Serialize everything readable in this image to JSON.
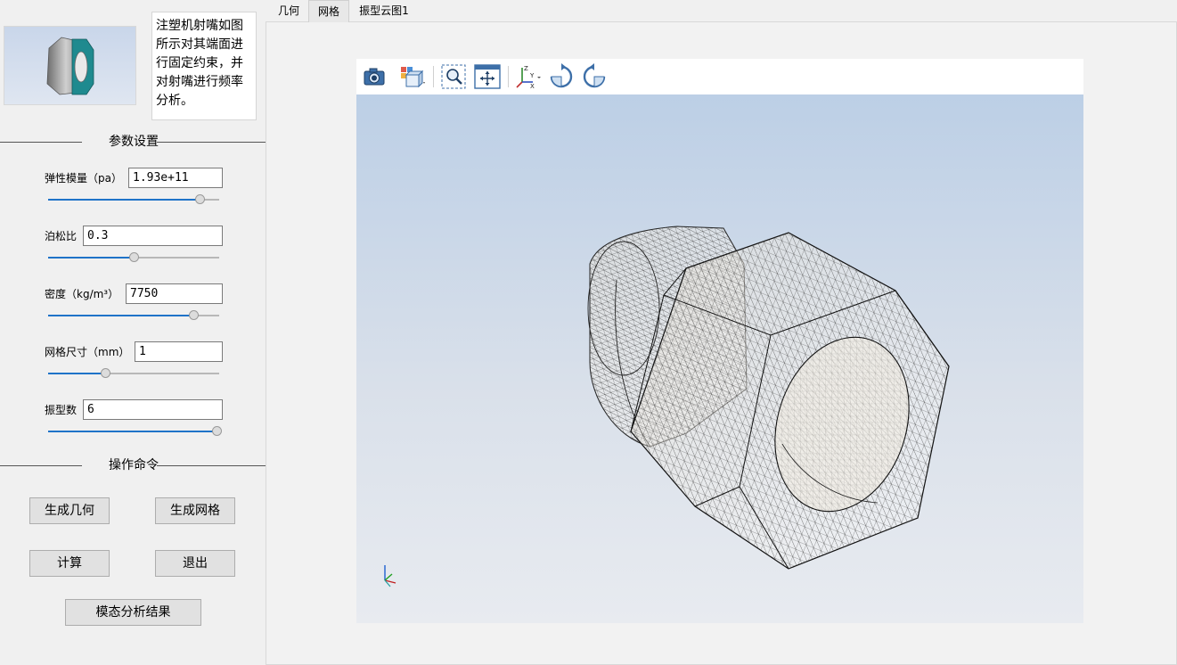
{
  "description": "注塑机射嘴如图所示对其端面进行固定约束，并对射嘴进行频率分析。",
  "sections": {
    "params_title": "参数设置",
    "ops_title": "操作命令"
  },
  "params": [
    {
      "label": "弹性模量（pa）",
      "value": "1.93e+11",
      "slider_fraction": 0.9
    },
    {
      "label": "泊松比",
      "value": "0.3",
      "slider_fraction": 0.5
    },
    {
      "label": "密度（kg/m³）",
      "value": "7750",
      "slider_fraction": 0.86
    },
    {
      "label": "网格尺寸（mm）",
      "value": "1",
      "slider_fraction": 0.33
    },
    {
      "label": "振型数",
      "value": "6",
      "slider_fraction": 1.0
    }
  ],
  "buttons": {
    "gen_geometry": "生成几何",
    "gen_mesh": "生成网格",
    "compute": "计算",
    "exit": "退出",
    "modal_results": "模态分析结果"
  },
  "tabs": [
    {
      "label": "几何",
      "active": false
    },
    {
      "label": "网格",
      "active": true
    },
    {
      "label": "振型云图1",
      "active": false
    }
  ],
  "toolbar_icons": [
    "camera-icon",
    "view-cube-icon",
    "zoom-box-icon",
    "fit-all-icon",
    "axes-icon",
    "rotate-cw-icon",
    "rotate-ccw-icon"
  ],
  "colors": {
    "slider_fill": "#1f73c8",
    "mesh_line": "#333333",
    "viewport_top": "#bccfe6",
    "viewport_bottom": "#e8ebf0"
  }
}
